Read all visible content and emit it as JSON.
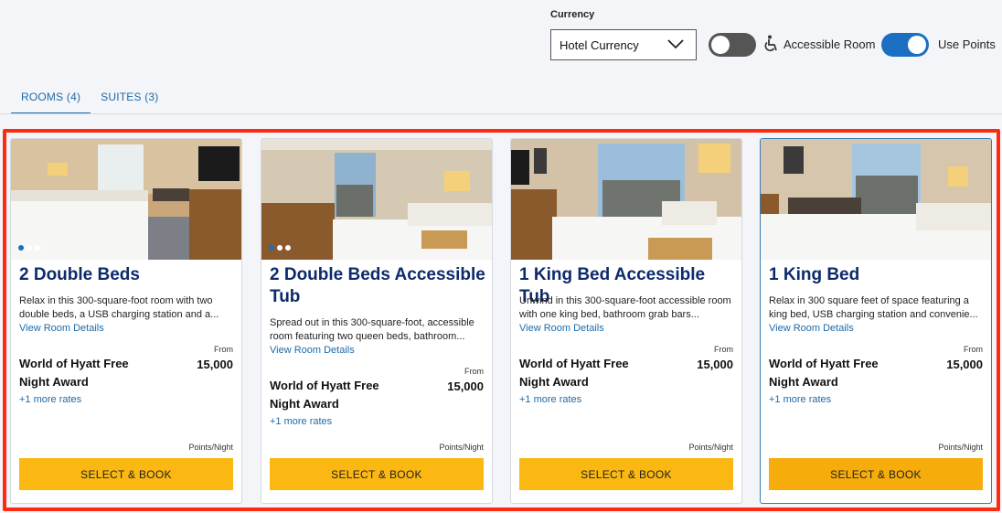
{
  "filters": {
    "currency_label": "Currency",
    "currency_value": "Hotel Currency",
    "accessible_label": "Accessible Room",
    "accessible_on": false,
    "points_label": "Use Points",
    "points_on": true
  },
  "tabs": [
    {
      "label": "ROOMS (4)",
      "active": true
    },
    {
      "label": "SUITES (3)",
      "active": false
    }
  ],
  "rooms": [
    {
      "title": "2 Double Beds",
      "description": "Relax in this 300-square-foot room with two double beds, a USB charging station and a...",
      "details_link": "View Room Details",
      "from_label": "From",
      "award": "World of Hyatt Free Night Award",
      "price": "15,000",
      "more_rates": "+1 more rates",
      "per_night": "Points/Night",
      "button": "SELECT & BOOK"
    },
    {
      "title": "2 Double Beds Accessible Tub",
      "description": "Spread out in this 300-square-foot, accessible room featuring two queen beds, bathroom...",
      "details_link": "View Room Details",
      "from_label": "From",
      "award": "World of Hyatt Free Night Award",
      "price": "15,000",
      "more_rates": "+1 more rates",
      "per_night": "Points/Night",
      "button": "SELECT & BOOK"
    },
    {
      "title": "1 King Bed Accessible Tub",
      "description": "Unwind in this 300-square-foot accessible room with one king bed, bathroom grab bars...",
      "details_link": "View Room Details",
      "from_label": "From",
      "award": "World of Hyatt Free Night Award",
      "price": "15,000",
      "more_rates": "+1 more rates",
      "per_night": "Points/Night",
      "button": "SELECT & BOOK"
    },
    {
      "title": "1 King Bed",
      "description": "Relax in 300 square feet of space featuring a king bed, USB charging station and convenie...",
      "details_link": "View Room Details",
      "from_label": "From",
      "award": "World of Hyatt Free Night Award",
      "price": "15,000",
      "more_rates": "+1 more rates",
      "per_night": "Points/Night",
      "button": "SELECT & BOOK"
    }
  ],
  "colors": {
    "accent": "#1b6fc3",
    "title": "#0d2a6b",
    "button": "#fbb812",
    "highlight": "#ff2a12"
  }
}
